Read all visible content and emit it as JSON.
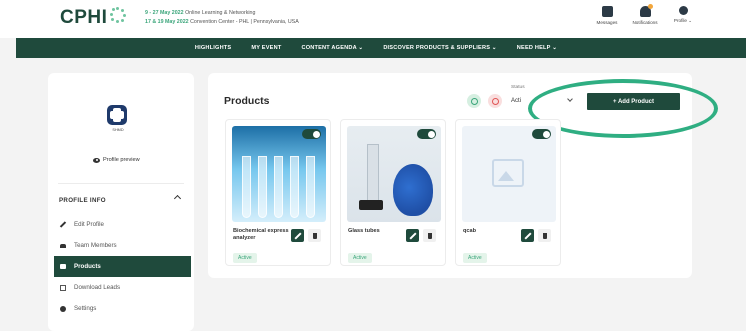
{
  "header": {
    "logo_text": "CPHI",
    "event_line1_date": "9 - 27 May 2022",
    "event_line1_text": "Online Learning & Networking",
    "event_line2_date": "17 & 19 May 2022",
    "event_line2_text": "Convention Center - PHL | Pennsylvania, USA",
    "messages_label": "Messages",
    "notifications_label": "Notifications",
    "profile_label": "Profile ⌄"
  },
  "nav": {
    "items": [
      "HIGHLIGHTS",
      "MY EVENT",
      "CONTENT AGENDA ⌄",
      "DISCOVER PRODUCTS & SUPPLIERS ⌄",
      "NEED HELP ⌄"
    ]
  },
  "sidebar": {
    "company_name": "SHMD",
    "profile_preview": "Profile preview",
    "section_title": "PROFILE INFO",
    "menu": [
      {
        "label": "Edit Profile",
        "icon": "pencil-icon"
      },
      {
        "label": "Team Members",
        "icon": "team-icon"
      },
      {
        "label": "Products",
        "icon": "cart-icon",
        "active": true
      },
      {
        "label": "Download Leads",
        "icon": "scan-icon"
      },
      {
        "label": "Settings",
        "icon": "gear-icon"
      }
    ]
  },
  "main": {
    "title": "Products",
    "status_label": "Status",
    "status_value": "Acti",
    "add_button": "+ Add Product",
    "products": [
      {
        "name": "Biochemical express analyzer",
        "status": "Active"
      },
      {
        "name": "Glass tubes",
        "status": "Active"
      },
      {
        "name": "qcab",
        "status": "Active"
      }
    ]
  },
  "colors": {
    "brand": "#1f4a3c",
    "accent": "#3aa57a",
    "highlight": "#2fae82"
  }
}
